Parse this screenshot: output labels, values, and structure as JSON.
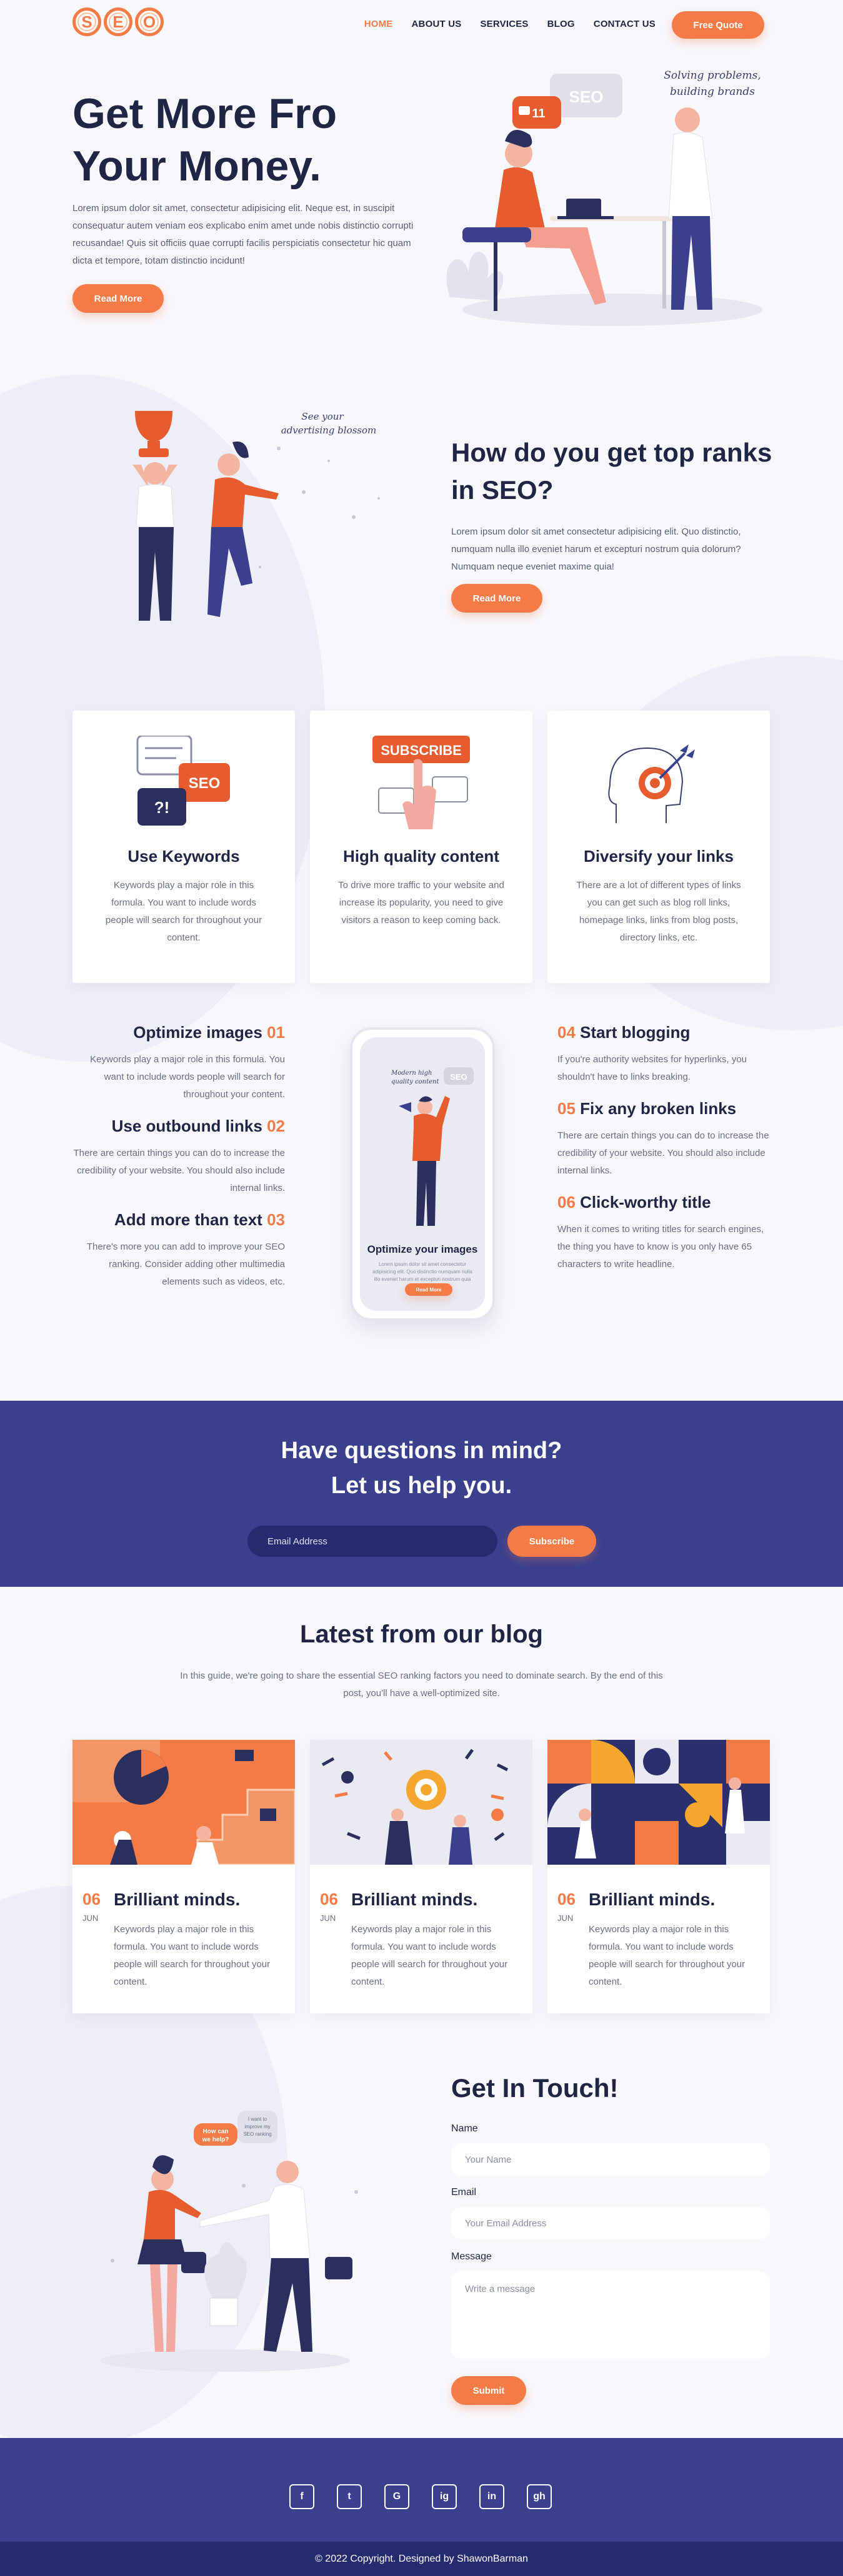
{
  "logo": {
    "letters": [
      "S",
      "E",
      "O"
    ]
  },
  "nav": {
    "items": [
      "HOME",
      "ABOUT US",
      "SERVICES",
      "BLOG",
      "CONTACT US"
    ],
    "active": "HOME",
    "quote_label": "Free Quote"
  },
  "hero": {
    "title": "Get More Fro Your Money.",
    "text": "Lorem ipsum dolor sit amet, consectetur adipisicing elit. Neque est, in suscipit consequatur autem veniam eos explicabo enim amet unde nobis distinctio corrupti recusandae! Quis sit officiis quae corrupti facilis perspiciatis consectetur hic quam dicta et tempore, totam distinctio incidunt!",
    "button": "Read More",
    "illustration": {
      "badge_count": "11",
      "bubble": "SEO",
      "handwriting": "Solving problems, building brands"
    }
  },
  "ranks": {
    "title": "How do you get top ranks in SEO?",
    "text": "Lorem ipsum dolor sit amet consectetur adipisicing elit. Quo distinctio, numquam nulla illo eveniet harum et excepturi nostrum quia dolorum? Numquam neque eveniet maxime quia!",
    "button": "Read More",
    "handwriting": "See your advertising blossom"
  },
  "features": [
    {
      "title": "Use Keywords",
      "text": "Keywords play a major role in this formula. You want to include words people will search for throughout your content.",
      "icon": "keywords-chat-icon",
      "icon_text": "SEO"
    },
    {
      "title": "High quality content",
      "text": "To drive more traffic to your website and increase its popularity, you need to give visitors a reason to keep coming back.",
      "icon": "subscribe-icon",
      "icon_text": "SUBSCRIBE"
    },
    {
      "title": "Diversify your links",
      "text": "There are a lot of different types of links you can get such as blog roll links, homepage links, links from blog posts, directory links, etc.",
      "icon": "head-target-icon"
    }
  ],
  "tips_left": [
    {
      "title": "Optimize images",
      "num": "01",
      "text": "Keywords play a major role in this formula. You want to include words people will search for throughout your content."
    },
    {
      "title": "Use outbound links",
      "num": "02",
      "text": "There are certain things you can do to increase the credibility of your website. You should also include internal links."
    },
    {
      "title": "Add more than text",
      "num": "03",
      "text": "There's more you can add to improve your SEO ranking. Consider adding other multimedia elements such as videos, etc."
    }
  ],
  "tips_right": [
    {
      "title": "Start blogging",
      "num": "04",
      "text": "If you're authority websites for hyperlinks, you shouldn't have to links breaking."
    },
    {
      "title": "Fix any broken links",
      "num": "05",
      "text": "There are certain things you can do to increase the credibility of your website. You should also include internal links."
    },
    {
      "title": "Click-worthy title",
      "num": "06",
      "text": "When it comes to writing titles for search engines, the thing you have to know is you only have 65 characters to write headline."
    }
  ],
  "phone": {
    "title": "Optimize your images",
    "text": "Lorem ipsum dolor sit amet consectetur adipisicing elit. Quo distinctio numquam nulla illo eveniet harum et excepturi nostrum quia dolorum.",
    "button": "Read More",
    "bubble": "SEO",
    "handwriting": "Modern high quality content"
  },
  "newsletter": {
    "title_line1": "Have questions in mind?",
    "title_line2": "Let us help you.",
    "placeholder": "Email Address",
    "button": "Subscribe"
  },
  "blog": {
    "title": "Latest from our blog",
    "text": "In this guide, we're going to share the essential SEO ranking factors you need to dominate search. By the end of this post, you'll have a well-optimized site.",
    "posts": [
      {
        "day": "06",
        "month": "JUN",
        "title": "Brilliant minds.",
        "text": "Keywords play a major role in this formula. You want to include words people will search for throughout your content."
      },
      {
        "day": "06",
        "month": "JUN",
        "title": "Brilliant minds.",
        "text": "Keywords play a major role in this formula. You want to include words people will search for throughout your content."
      },
      {
        "day": "06",
        "month": "JUN",
        "title": "Brilliant minds.",
        "text": "Keywords play a major role in this formula. You want to include words people will search for throughout your content."
      }
    ]
  },
  "contact": {
    "title": "Get In Touch!",
    "name_label": "Name",
    "name_placeholder": "Your Name",
    "email_label": "Email",
    "email_placeholder": "Your Email Address",
    "message_label": "Message",
    "message_placeholder": "Write a message",
    "button": "Submit",
    "bubble_left": "How can we help?",
    "bubble_right": "I want to improve my SEO ranking"
  },
  "footer": {
    "socials": [
      "f",
      "t",
      "G",
      "ig",
      "in",
      "gh"
    ],
    "social_names": [
      "facebook-icon",
      "twitter-icon",
      "google-icon",
      "instagram-icon",
      "linkedin-icon",
      "github-icon"
    ],
    "copyright": "© 2022 Copyright. Designed by ShawonBarman"
  },
  "colors": {
    "accent": "#f47b46",
    "navy": "#1f2544",
    "band": "#3a3f8e",
    "band_dark": "#262a6e",
    "background": "#f8f7fc"
  }
}
